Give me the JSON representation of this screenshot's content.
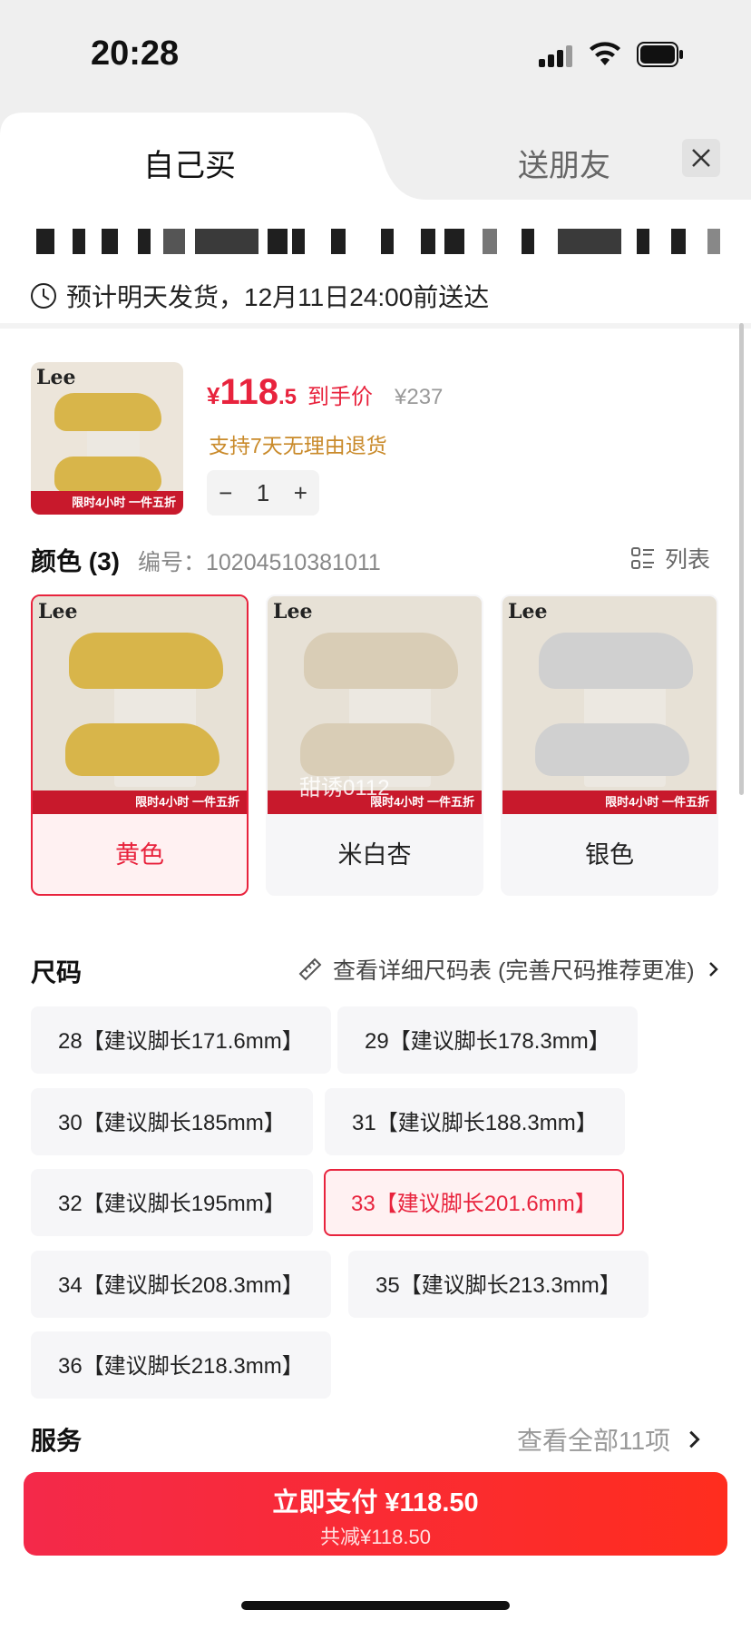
{
  "status_bar": {
    "time": "20:28"
  },
  "tabs": {
    "self": "自己买",
    "friend": "送朋友"
  },
  "shipping": {
    "text": "预计明天发货，12月11日24:00前送达"
  },
  "product": {
    "price_currency": "¥",
    "price_int": "118",
    "price_dec": ".5",
    "price_label": "到手价",
    "original_price": "¥237",
    "return_policy": "支持7天无理由退货",
    "quantity": "1",
    "thumb_logo": "Lee",
    "promo_text": "限时4小时 一件五折"
  },
  "colors": {
    "title": "颜色 (3)",
    "sku_label": "编号：10204510381011",
    "list_toggle": "列表",
    "watermark": "甜诱0112",
    "options": [
      {
        "label": "黄色",
        "selected": true,
        "shoe_color": "#d8b54a"
      },
      {
        "label": "米白杏",
        "selected": false,
        "shoe_color": "#d9cdb6"
      },
      {
        "label": "银色",
        "selected": false,
        "shoe_color": "#d0d0d0"
      }
    ]
  },
  "sizes": {
    "title": "尺码",
    "guide": "查看详细尺码表 (完善尺码推荐更准)",
    "options": [
      {
        "label": "28【建议脚长171.6mm】",
        "selected": false
      },
      {
        "label": "29【建议脚长178.3mm】",
        "selected": false
      },
      {
        "label": "30【建议脚长185mm】",
        "selected": false
      },
      {
        "label": "31【建议脚长188.3mm】",
        "selected": false
      },
      {
        "label": "32【建议脚长195mm】",
        "selected": false
      },
      {
        "label": "33【建议脚长201.6mm】",
        "selected": true
      },
      {
        "label": "34【建议脚长208.3mm】",
        "selected": false
      },
      {
        "label": "35【建议脚长213.3mm】",
        "selected": false
      },
      {
        "label": "36【建议脚长218.3mm】",
        "selected": false
      }
    ]
  },
  "services": {
    "title": "服务",
    "more": "查看全部11项"
  },
  "pay": {
    "main": "立即支付 ¥118.50",
    "sub": "共减¥118.50"
  },
  "colors_theme": {
    "accent": "#e8233d",
    "return_note": "#c98a2a"
  }
}
